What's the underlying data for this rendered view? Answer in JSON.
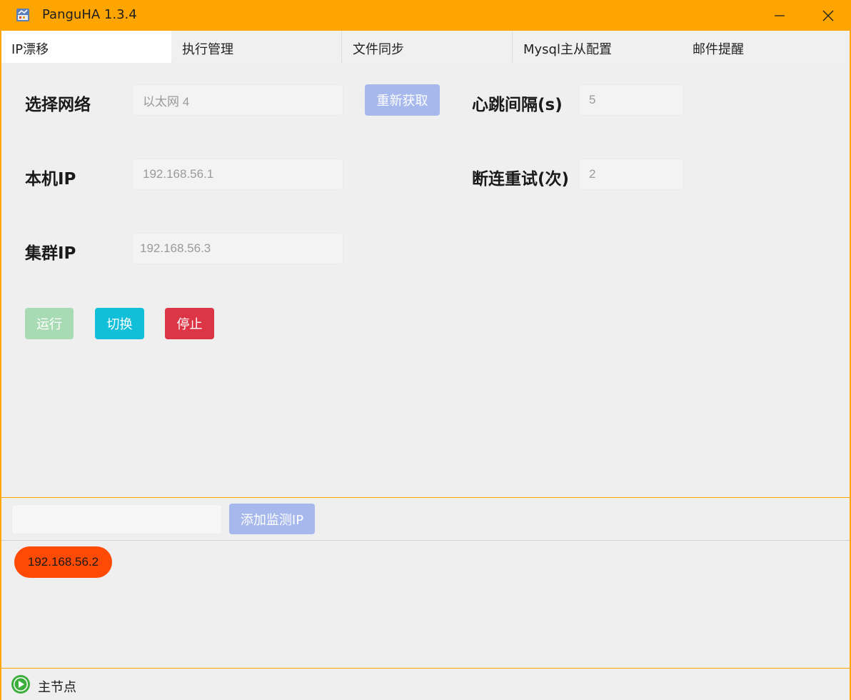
{
  "app": {
    "title": "PanguHA 1.3.4"
  },
  "tabs": [
    {
      "label": "IP漂移",
      "active": true
    },
    {
      "label": "执行管理",
      "active": false
    },
    {
      "label": "文件同步",
      "active": false
    },
    {
      "label": "Mysql主从配置",
      "active": false
    },
    {
      "label": "邮件提醒",
      "active": false
    }
  ],
  "form": {
    "network_label": "选择网络",
    "network_value": "以太网 4",
    "refresh_button": "重新获取",
    "heartbeat_label": "心跳间隔(s)",
    "heartbeat_value": "5",
    "local_ip_label": "本机IP",
    "local_ip_value": "192.168.56.1",
    "retry_label": "断连重试(次)",
    "retry_value": "2",
    "cluster_ip_label": "集群IP",
    "cluster_ip_value": "192.168.56.3"
  },
  "actions": {
    "run": "运行",
    "switch": "切换",
    "stop": "停止"
  },
  "monitor": {
    "input_value": "",
    "add_button": "添加监测IP",
    "ips": [
      "192.168.56.2"
    ]
  },
  "status": {
    "text": "主节点",
    "icon": "play-circle-icon"
  },
  "colors": {
    "titlebar": "#ffa500",
    "chip": "#ff4a05",
    "run": "#a8dbb4",
    "switch": "#12bfd8",
    "stop": "#dc3545",
    "primary_disabled": "#a7b8ec",
    "status_icon": "#3cae3c"
  }
}
